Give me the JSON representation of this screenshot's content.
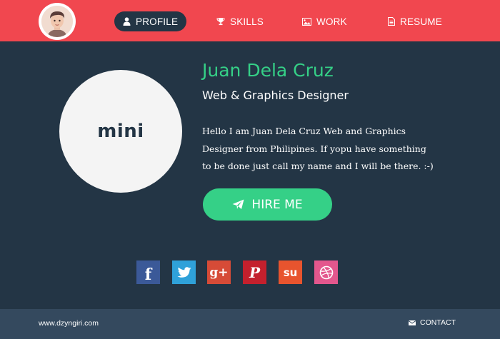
{
  "header": {
    "nav": [
      {
        "label": "PROFILE",
        "icon": "user-icon",
        "active": true
      },
      {
        "label": "SKILLS",
        "icon": "trophy-icon",
        "active": false
      },
      {
        "label": "WORK",
        "icon": "picture-icon",
        "active": false
      },
      {
        "label": "RESUME",
        "icon": "document-icon",
        "active": false
      }
    ]
  },
  "profile": {
    "photo_text": "mini",
    "name": "Juan Dela Cruz",
    "role": "Web & Graphics Designer",
    "bio": "Hello I am Juan Dela Cruz Web and Graphics Designer from Philipines. If yopu have something to be done just call my name and I will be there. :-)",
    "hire_label": "HIRE ME"
  },
  "socials": [
    {
      "name": "facebook",
      "glyph": "f",
      "color": "#3b5998"
    },
    {
      "name": "twitter",
      "glyph": "",
      "color": "#2fa1d9"
    },
    {
      "name": "google-plus",
      "glyph": "g+",
      "color": "#d64b37"
    },
    {
      "name": "pinterest",
      "glyph": "P",
      "color": "#c4202d"
    },
    {
      "name": "stumbleupon",
      "glyph": "su",
      "color": "#e8542e"
    },
    {
      "name": "dribbble",
      "glyph": "",
      "color": "#e3578d"
    }
  ],
  "footer": {
    "url": "www.dzyngiri.com",
    "contact_label": "CONTACT"
  },
  "colors": {
    "header_bg": "#f1474f",
    "body_bg": "#233545",
    "accent_green": "#35d087",
    "footer_bg": "#34495e"
  }
}
